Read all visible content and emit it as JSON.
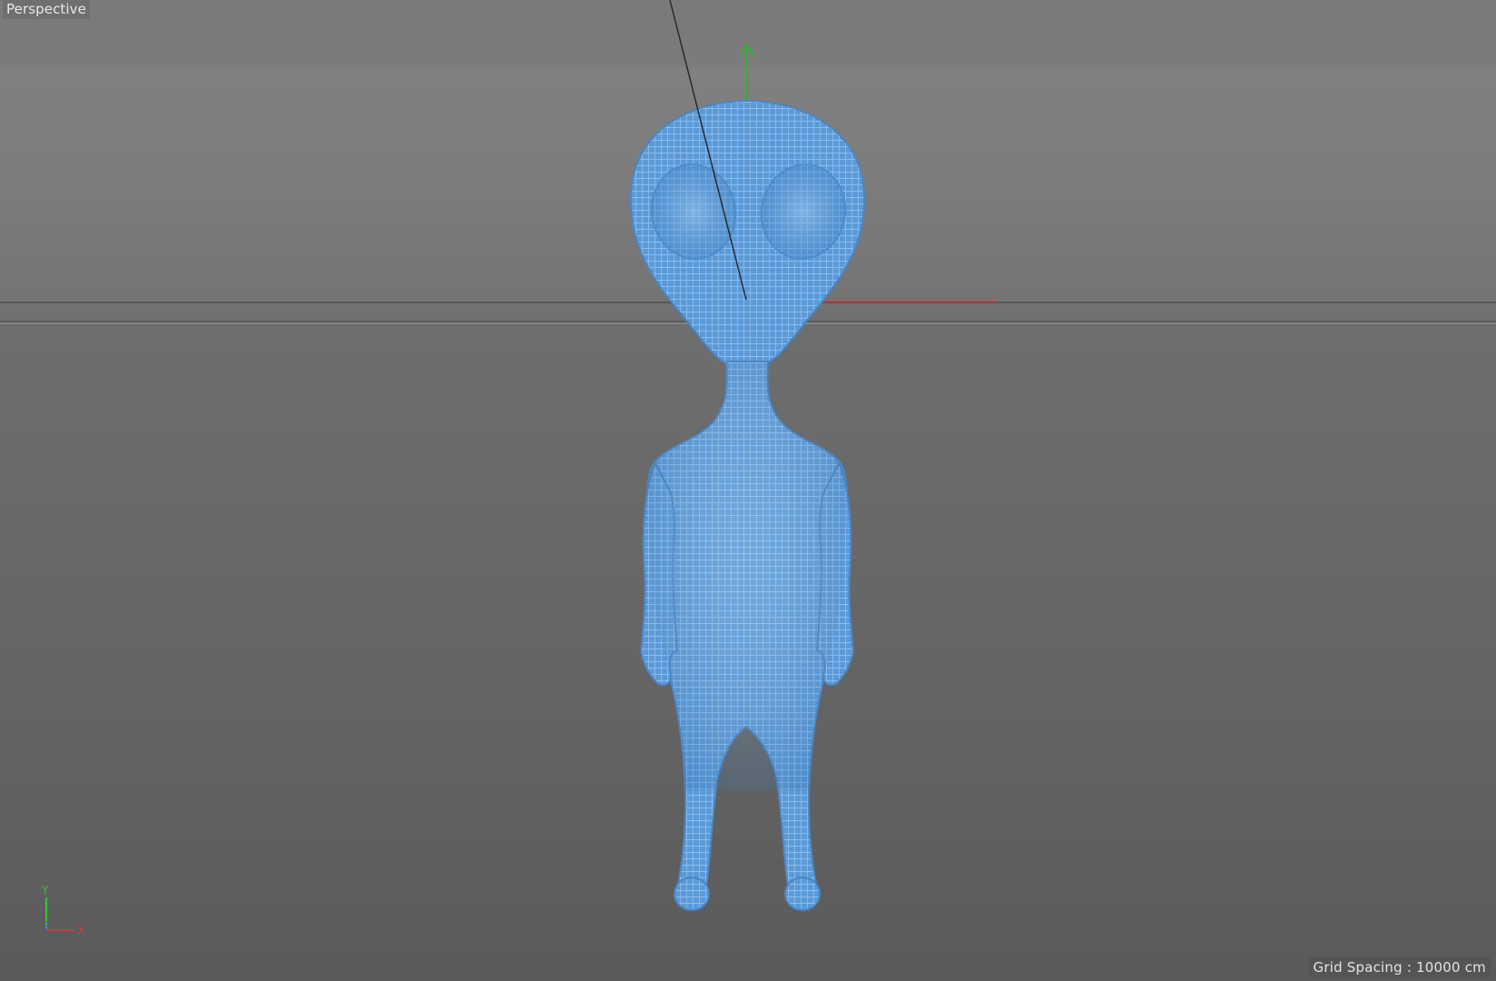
{
  "viewport": {
    "view_label": "Perspective",
    "grid_spacing_label": "Grid Spacing : 10000 cm",
    "object": {
      "name": "alien",
      "display": "wireframe",
      "color": "#5b9ad8",
      "wire_color": "#7eb3e6"
    },
    "axis_gizmo": {
      "y_label": "Y",
      "x_label": "X",
      "y_color": "#39c239",
      "x_color": "#d03a3a",
      "z_color": "#4a6ad0"
    },
    "world_axes": {
      "y_color": "#2fb32f",
      "x_color": "#c53a3a"
    }
  }
}
